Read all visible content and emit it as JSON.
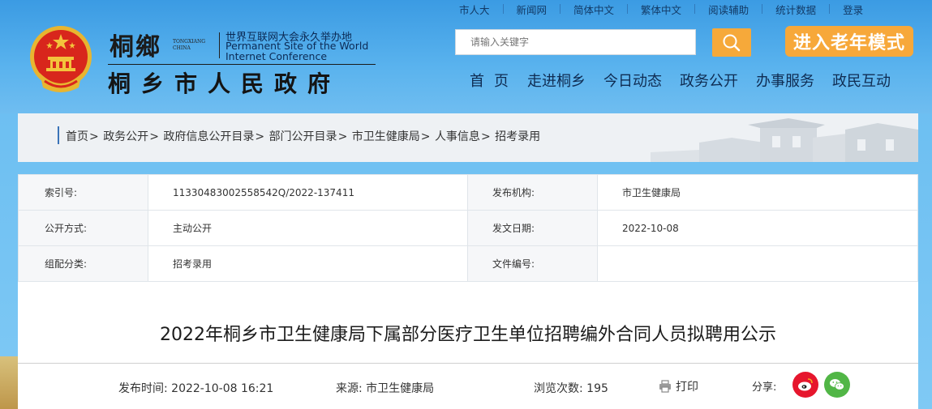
{
  "toplinks": [
    "市人大",
    "新闻网",
    "简体中文",
    "繁体中文",
    "阅读辅助",
    "统计数据",
    "登录"
  ],
  "logo": {
    "calligraphy": "桐鄉",
    "tongxiang_small": "TONGXIANG\nCHINA",
    "wic_cn": "世界互联网大会永久举办地",
    "wic_en_line1": "Permanent Site of the World",
    "wic_en_line2": "Internet Conference",
    "gov_name": "桐乡市人民政府"
  },
  "search": {
    "placeholder": "请输入关键字"
  },
  "elder_mode": "进入老年模式",
  "nav": [
    "首页",
    "走进桐乡",
    "今日动态",
    "政务公开",
    "办事服务",
    "政民互动"
  ],
  "breadcrumb": [
    "首页",
    "政务公开",
    "政府信息公开目录",
    "部门公开目录",
    "市卫生健康局",
    "人事信息",
    "招考录用"
  ],
  "info": {
    "index_label": "索引号:",
    "index_value": "11330483002558542Q/2022-137411",
    "publisher_label": "发布机构:",
    "publisher_value": "市卫生健康局",
    "mode_label": "公开方式:",
    "mode_value": "主动公开",
    "date_label": "发文日期:",
    "date_value": "2022-10-08",
    "category_label": "组配分类:",
    "category_value": "招考录用",
    "docno_label": "文件编号:",
    "docno_value": ""
  },
  "article": {
    "title": "2022年桐乡市卫生健康局下属部分医疗卫生单位招聘编外合同人员拟聘用公示",
    "publish_time": "发布时间:  2022-10-08  16:21",
    "source": "来源:  市卫生健康局",
    "views": "浏览次数:  195",
    "print": "打印",
    "share_label": "分享:"
  },
  "colors": {
    "accent_orange": "#f7a83a",
    "sky": "#4aa6e6",
    "weibo": "#e6162d",
    "wechat": "#51b646"
  }
}
